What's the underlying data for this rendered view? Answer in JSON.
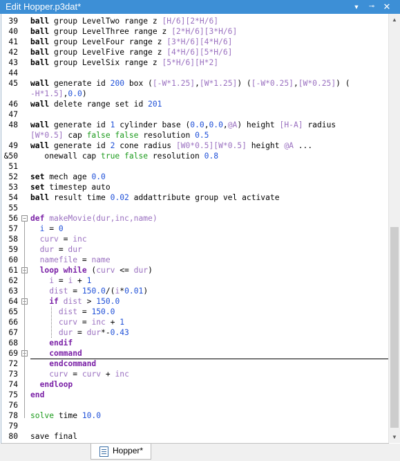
{
  "window": {
    "title": "Edit Hopper.p3dat*"
  },
  "tab": {
    "label": "Hopper*"
  },
  "lines": [
    {
      "n": "39",
      "segs": [
        [
          "kw",
          "ball"
        ],
        [
          "",
          "group LevelTwo range z "
        ],
        [
          "lav",
          "[H/6][2*H/6]"
        ]
      ]
    },
    {
      "n": "40",
      "segs": [
        [
          "kw",
          "ball"
        ],
        [
          "",
          "group LevelThree range z "
        ],
        [
          "lav",
          "[2*H/6][3*H/6]"
        ]
      ]
    },
    {
      "n": "41",
      "segs": [
        [
          "kw",
          "ball"
        ],
        [
          "",
          "group LevelFour range z "
        ],
        [
          "lav",
          "[3*H/6][4*H/6]"
        ]
      ]
    },
    {
      "n": "42",
      "segs": [
        [
          "kw",
          "ball"
        ],
        [
          "",
          "group LevelFive range z "
        ],
        [
          "lav",
          "[4*H/6][5*H/6]"
        ]
      ]
    },
    {
      "n": "43",
      "segs": [
        [
          "kw",
          "ball"
        ],
        [
          "",
          "group LevelSix range z "
        ],
        [
          "lav",
          "[5*H/6][H*2]"
        ]
      ]
    },
    {
      "n": "44",
      "segs": []
    },
    {
      "n": "45",
      "segs": [
        [
          "kw",
          "wall"
        ],
        [
          "",
          "generate id "
        ],
        [
          "blue",
          "200"
        ],
        [
          "",
          " box ("
        ],
        [
          "lav",
          "[-W*1.25]"
        ],
        [
          "",
          ","
        ],
        [
          "lav",
          "[W*1.25]"
        ],
        [
          "",
          ") ("
        ],
        [
          "lav",
          "[-W*0.25]"
        ],
        [
          "",
          ","
        ],
        [
          "lav",
          "[W*0.25]"
        ],
        [
          "",
          ") ("
        ]
      ]
    },
    {
      "n": "",
      "segs": [
        [
          "lav",
          "-H*1.5]"
        ],
        [
          "",
          ","
        ],
        [
          "blue",
          "0.0"
        ],
        [
          "",
          ")"
        ]
      ]
    },
    {
      "n": "46",
      "segs": [
        [
          "kw",
          "wall"
        ],
        [
          "",
          "delete range set id "
        ],
        [
          "blue",
          "201"
        ]
      ]
    },
    {
      "n": "47",
      "segs": []
    },
    {
      "n": "48",
      "segs": [
        [
          "kw",
          "wall"
        ],
        [
          "",
          "generate id "
        ],
        [
          "blue",
          "1"
        ],
        [
          "",
          " cylinder base ("
        ],
        [
          "blue",
          "0.0"
        ],
        [
          "",
          ","
        ],
        [
          "blue",
          "0.0"
        ],
        [
          "",
          ","
        ],
        [
          "lav",
          "@A"
        ],
        [
          "",
          ") height "
        ],
        [
          "lav",
          "[H-A]"
        ],
        [
          "",
          " radius"
        ]
      ]
    },
    {
      "n": "",
      "segs": [
        [
          "lav",
          "[W*0.5]"
        ],
        [
          "",
          " cap "
        ],
        [
          "green",
          "false false"
        ],
        [
          "",
          " resolution "
        ],
        [
          "blue",
          "0.5"
        ]
      ]
    },
    {
      "n": "49",
      "segs": [
        [
          "kw",
          "wall"
        ],
        [
          "",
          "generate id "
        ],
        [
          "blue",
          "2"
        ],
        [
          "",
          " cone radius "
        ],
        [
          "lav",
          "[W0*0.5]"
        ],
        [
          "",
          ""
        ],
        [
          "lav",
          "[W*0.5]"
        ],
        [
          "",
          " height "
        ],
        [
          "lav",
          "@A"
        ],
        [
          "",
          " ..."
        ]
      ]
    },
    {
      "n": "&50",
      "segs": [
        [
          "",
          "   onewall cap "
        ],
        [
          "green",
          "true false"
        ],
        [
          "",
          " resolution "
        ],
        [
          "blue",
          "0.8"
        ]
      ]
    },
    {
      "n": "51",
      "segs": []
    },
    {
      "n": "52",
      "segs": [
        [
          "kw",
          "set"
        ],
        [
          "",
          "mech age "
        ],
        [
          "blue",
          "0.0"
        ]
      ]
    },
    {
      "n": "53",
      "segs": [
        [
          "kw",
          "set"
        ],
        [
          "",
          "timestep auto"
        ]
      ]
    },
    {
      "n": "54",
      "segs": [
        [
          "kw",
          "ball"
        ],
        [
          "",
          "result time "
        ],
        [
          "blue",
          "0.02"
        ],
        [
          "",
          " addattribute group vel activate"
        ]
      ]
    },
    {
      "n": "55",
      "segs": []
    },
    {
      "n": "56",
      "segs": [
        [
          "purple",
          "def"
        ],
        [
          "",
          ""
        ],
        [
          "lav",
          "makeMovie"
        ],
        [
          "lav",
          "(dur,inc,name)"
        ]
      ]
    },
    {
      "n": "57",
      "segs": [
        [
          "",
          "  "
        ],
        [
          "blue",
          "i"
        ],
        [
          "",
          " = "
        ],
        [
          "blue",
          "0"
        ]
      ]
    },
    {
      "n": "58",
      "segs": [
        [
          "",
          "  "
        ],
        [
          "lav",
          "curv"
        ],
        [
          "",
          " = "
        ],
        [
          "lav",
          "inc"
        ]
      ]
    },
    {
      "n": "59",
      "segs": [
        [
          "",
          "  "
        ],
        [
          "lav",
          "dur"
        ],
        [
          "",
          " = "
        ],
        [
          "lav",
          "dur"
        ]
      ]
    },
    {
      "n": "60",
      "segs": [
        [
          "",
          "  "
        ],
        [
          "lav",
          "namefile"
        ],
        [
          "",
          " = "
        ],
        [
          "lav",
          "name"
        ]
      ]
    },
    {
      "n": "61",
      "segs": [
        [
          "",
          "  "
        ],
        [
          "purple",
          "loop while"
        ],
        [
          "",
          " ("
        ],
        [
          "lav",
          "curv"
        ],
        [
          "",
          " <= "
        ],
        [
          "lav",
          "dur"
        ],
        [
          "",
          ")"
        ]
      ]
    },
    {
      "n": "62",
      "segs": [
        [
          "",
          "    "
        ],
        [
          "lav",
          "i"
        ],
        [
          "",
          " = "
        ],
        [
          "lav",
          "i"
        ],
        [
          "",
          " + "
        ],
        [
          "blue",
          "1"
        ]
      ]
    },
    {
      "n": "63",
      "segs": [
        [
          "",
          "    "
        ],
        [
          "lav",
          "dist"
        ],
        [
          "",
          " = "
        ],
        [
          "blue",
          "150.0"
        ],
        [
          "",
          "/("
        ],
        [
          "lav",
          "i"
        ],
        [
          "",
          "*"
        ],
        [
          "blue",
          "0.01"
        ],
        [
          "",
          ")"
        ]
      ]
    },
    {
      "n": "64",
      "segs": [
        [
          "",
          "    "
        ],
        [
          "purple",
          "if"
        ],
        [
          "",
          " "
        ],
        [
          "lav",
          "dist"
        ],
        [
          "",
          " > "
        ],
        [
          "blue",
          "150.0"
        ]
      ]
    },
    {
      "n": "65",
      "segs": [
        [
          "",
          "      "
        ],
        [
          "lav",
          "dist"
        ],
        [
          "",
          " = "
        ],
        [
          "blue",
          "150.0"
        ]
      ]
    },
    {
      "n": "66",
      "segs": [
        [
          "",
          "      "
        ],
        [
          "lav",
          "curv"
        ],
        [
          "",
          " = "
        ],
        [
          "lav",
          "inc"
        ],
        [
          "",
          " + "
        ],
        [
          "blue",
          "1"
        ]
      ]
    },
    {
      "n": "67",
      "segs": [
        [
          "",
          "      "
        ],
        [
          "lav",
          "dur"
        ],
        [
          "",
          " = "
        ],
        [
          "lav",
          "dur"
        ],
        [
          "",
          "*-"
        ],
        [
          "blue",
          "0.43"
        ]
      ]
    },
    {
      "n": "68",
      "segs": [
        [
          "",
          "    "
        ],
        [
          "purple",
          "endif"
        ]
      ]
    },
    {
      "n": "69",
      "segs": [
        [
          "",
          "    "
        ],
        [
          "purple",
          "command"
        ]
      ]
    },
    {
      "n": "72",
      "segs": [
        [
          "",
          "    "
        ],
        [
          "purple",
          "endcommand"
        ]
      ]
    },
    {
      "n": "73",
      "segs": [
        [
          "",
          "    "
        ],
        [
          "lav",
          "curv"
        ],
        [
          "",
          " = "
        ],
        [
          "lav",
          "curv"
        ],
        [
          "",
          " + "
        ],
        [
          "lav",
          "inc"
        ]
      ]
    },
    {
      "n": "74",
      "segs": [
        [
          "",
          "  "
        ],
        [
          "purple",
          "endloop"
        ]
      ]
    },
    {
      "n": "75",
      "segs": [
        [
          "purple",
          "end"
        ]
      ]
    },
    {
      "n": "76",
      "segs": []
    },
    {
      "n": "78",
      "segs": [
        [
          "green",
          "solve"
        ],
        [
          "",
          " time "
        ],
        [
          "blue",
          "10.0"
        ]
      ]
    },
    {
      "n": "79",
      "segs": []
    },
    {
      "n": "80",
      "segs": [
        [
          "",
          "save final"
        ]
      ]
    }
  ],
  "icons": {
    "scroll_up": "▲",
    "scroll_down": "▼",
    "close": "✕",
    "pin": "📌",
    "dropdown": "▾"
  }
}
